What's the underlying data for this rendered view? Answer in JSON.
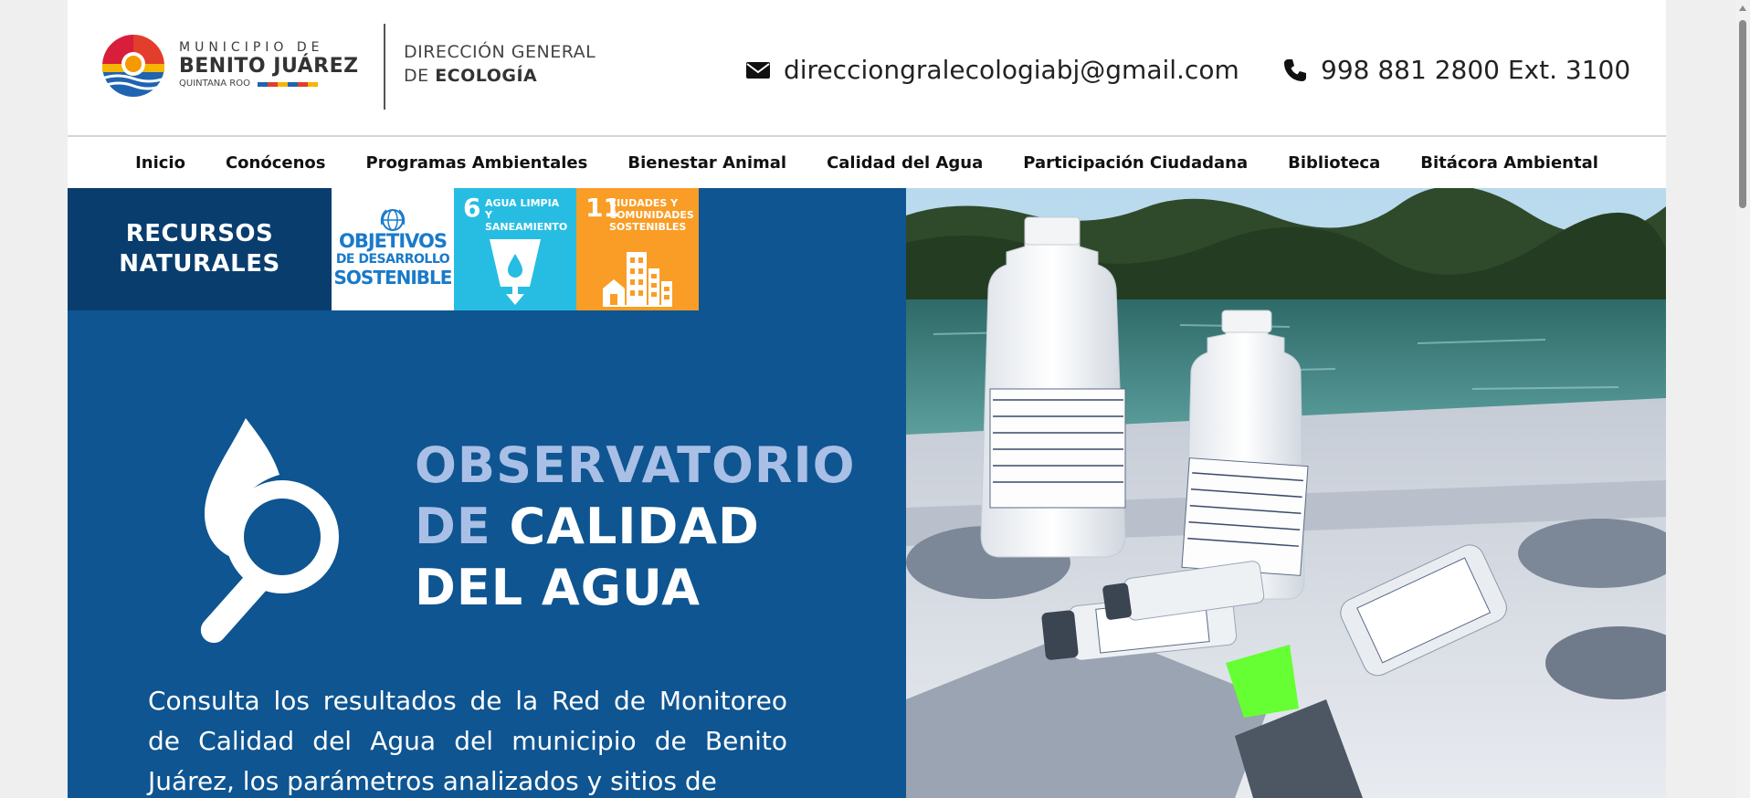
{
  "header": {
    "logo": {
      "municipio": "MUNICIPIO DE",
      "city": "BENITO JUÁREZ",
      "state": "QUINTANA ROO"
    },
    "direccion_line1": "DIRECCIÓN GENERAL",
    "direccion_line2_prefix": "DE ",
    "direccion_line2_bold": "ECOLOGÍA",
    "email": "direcciongralecologiabj@gmail.com",
    "phone": "998 881 2800 Ext. 3100",
    "icons": {
      "email": "envelope-icon",
      "phone": "phone-icon"
    }
  },
  "nav": {
    "items": [
      {
        "label": "Inicio"
      },
      {
        "label": "Conócenos"
      },
      {
        "label": "Programas Ambientales"
      },
      {
        "label": "Bienestar Animal"
      },
      {
        "label": "Calidad del Agua"
      },
      {
        "label": "Participación Ciudadana"
      },
      {
        "label": "Biblioteca"
      },
      {
        "label": "Bitácora Ambiental"
      }
    ]
  },
  "hero": {
    "badge_line1": "RECURSOS",
    "badge_line2": "NATURALES",
    "ods": {
      "un_line1": "OBJETIVOS",
      "un_line2": "DE DESARROLLO",
      "un_line3": "SOSTENIBLE",
      "goal6_number": "6",
      "goal6_label": "AGUA LIMPIA Y SANEAMIENTO",
      "goal11_number": "11",
      "goal11_label": "CIUDADES Y COMUNIDADES SOSTENIBLES"
    },
    "title_line1": "OBSERVATORIO",
    "title_line2_light": "DE ",
    "title_line2_white": "CALIDAD",
    "title_line3": "DEL AGUA",
    "description": "Consulta los resultados de la Red de Monitoreo de Calidad del Agua del municipio de Benito Juárez, los parámetros analizados y sitios de",
    "colors": {
      "panel": "#0e5591",
      "badge": "#093d6e",
      "title_light": "#a9bfe6",
      "ods6": "#27bde2",
      "ods11": "#f99d26"
    }
  }
}
